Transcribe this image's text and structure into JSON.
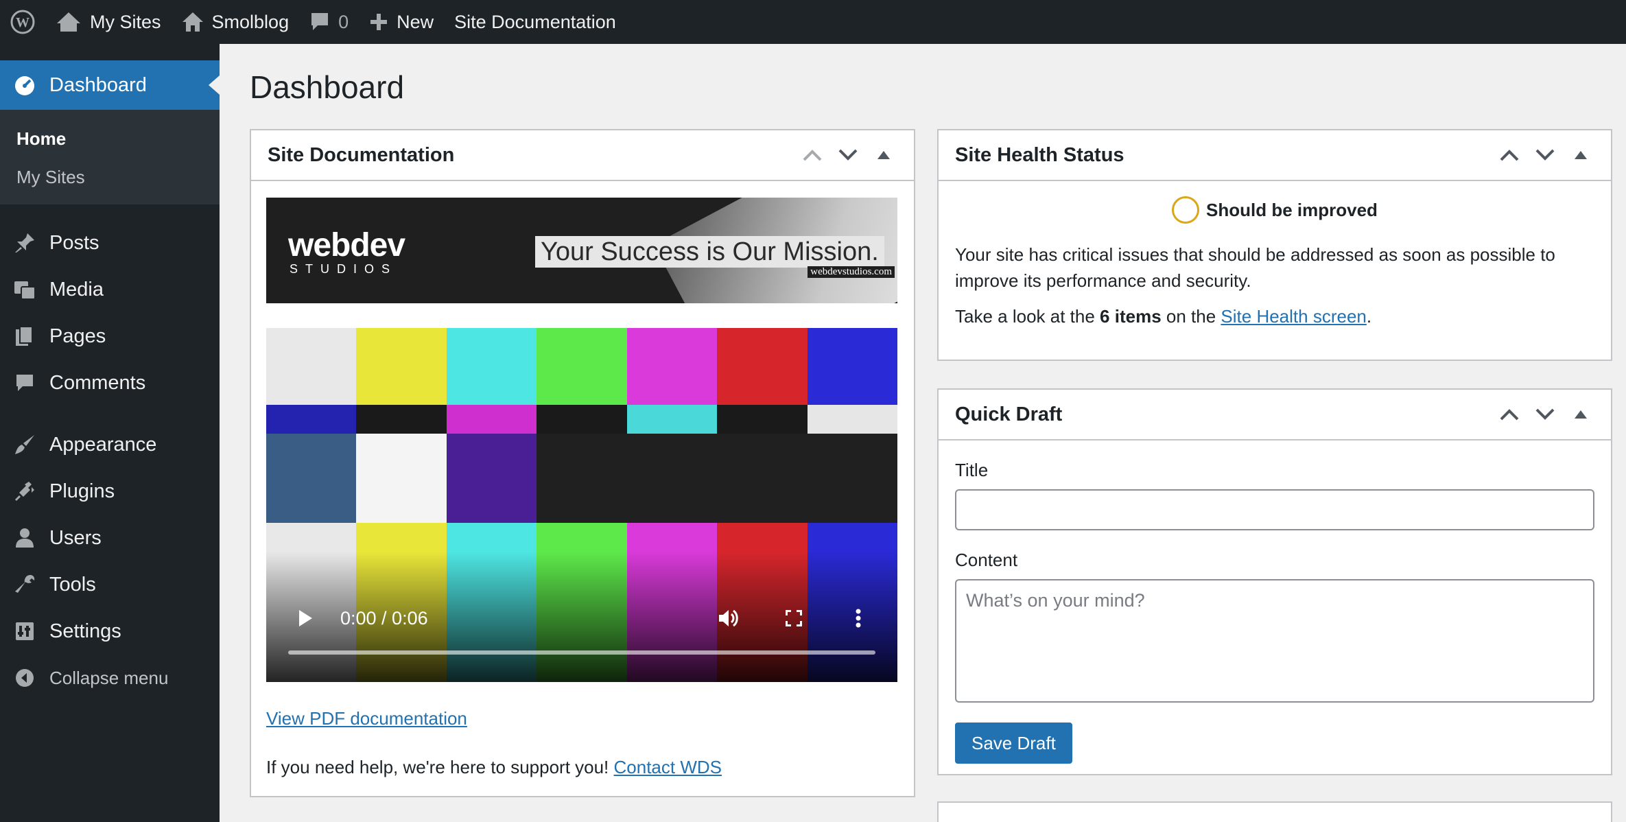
{
  "adminbar": {
    "my_sites": "My Sites",
    "site_name": "Smolblog",
    "comments_count": "0",
    "new_label": "New",
    "site_doc_label": "Site Documentation"
  },
  "sidebar": {
    "dashboard": "Dashboard",
    "submenu": [
      "Home",
      "My Sites"
    ],
    "items": [
      {
        "label": "Posts",
        "icon": "pushpin-icon"
      },
      {
        "label": "Media",
        "icon": "media-icon"
      },
      {
        "label": "Pages",
        "icon": "pages-icon"
      },
      {
        "label": "Comments",
        "icon": "comments-icon"
      },
      {
        "label": "Appearance",
        "icon": "paintbrush-icon"
      },
      {
        "label": "Plugins",
        "icon": "plugin-icon"
      },
      {
        "label": "Users",
        "icon": "users-icon"
      },
      {
        "label": "Tools",
        "icon": "wrench-icon"
      },
      {
        "label": "Settings",
        "icon": "settings-icon"
      }
    ],
    "collapse": "Collapse menu"
  },
  "page_title": "Dashboard",
  "site_doc": {
    "title": "Site Documentation",
    "banner_logo": "webdev",
    "banner_logo_sub": "STUDIOS",
    "banner_tagline": "Your Success is Our Mission.",
    "banner_url": "webdevstudios.com",
    "video_time": "0:00 / 0:06",
    "pdf_link": "View PDF documentation",
    "help_text": "If you need help, we're here to support you!",
    "contact_link": "Contact WDS"
  },
  "site_health": {
    "title": "Site Health Status",
    "status": "Should be improved",
    "description": "Your site has critical issues that should be addressed as soon as possible to improve its performance and security.",
    "items_prefix": "Take a look at the",
    "items_count": "6 items",
    "items_mid": "on the",
    "items_link": "Site Health screen",
    "items_suffix": "."
  },
  "quick_draft": {
    "title": "Quick Draft",
    "title_label": "Title",
    "title_value": "",
    "content_label": "Content",
    "content_placeholder": "What’s on your mind?",
    "save_button": "Save Draft"
  },
  "colors": {
    "admin_bg": "#1d2327",
    "accent": "#2271b1",
    "health_warning": "#dba617",
    "test_bars_top": [
      "#e8e8e8",
      "#e9e63a",
      "#4ee6e3",
      "#5ee94a",
      "#d93ad9",
      "#d6262c",
      "#2a2ad6"
    ],
    "test_bars_mid": [
      "#2323b0",
      "#1a1a1a",
      "#cf2fcf",
      "#1a1a1a",
      "#4ad8d8",
      "#1a1a1a",
      "#e6e6e6"
    ],
    "test_bars_low": [
      "#3a5d86",
      "#f4f4f4",
      "#4a1f96",
      "#202020",
      "#202020",
      "#202020",
      "#202020"
    ],
    "test_bars_bot": [
      "#e8e8e8",
      "#e9e63a",
      "#4ee6e3",
      "#5ee94a",
      "#d93ad9",
      "#d6262c",
      "#2a2ad6"
    ]
  }
}
